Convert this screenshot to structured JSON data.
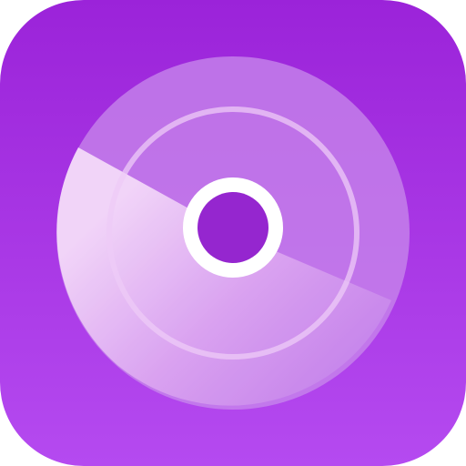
{
  "icon": {
    "name": "disc-app-icon",
    "glyph": "disc-icon",
    "colors": {
      "background_top": "#9B23D9",
      "background_bottom": "#B54AF0",
      "disc_light": "#F3D6F9",
      "disc_mid": "#D79BEF",
      "disc_outer": "#C27BEA",
      "hub_ring": "#FFFFFF",
      "hub_center": "#9526CF",
      "groove": "#EDCBF7"
    }
  }
}
